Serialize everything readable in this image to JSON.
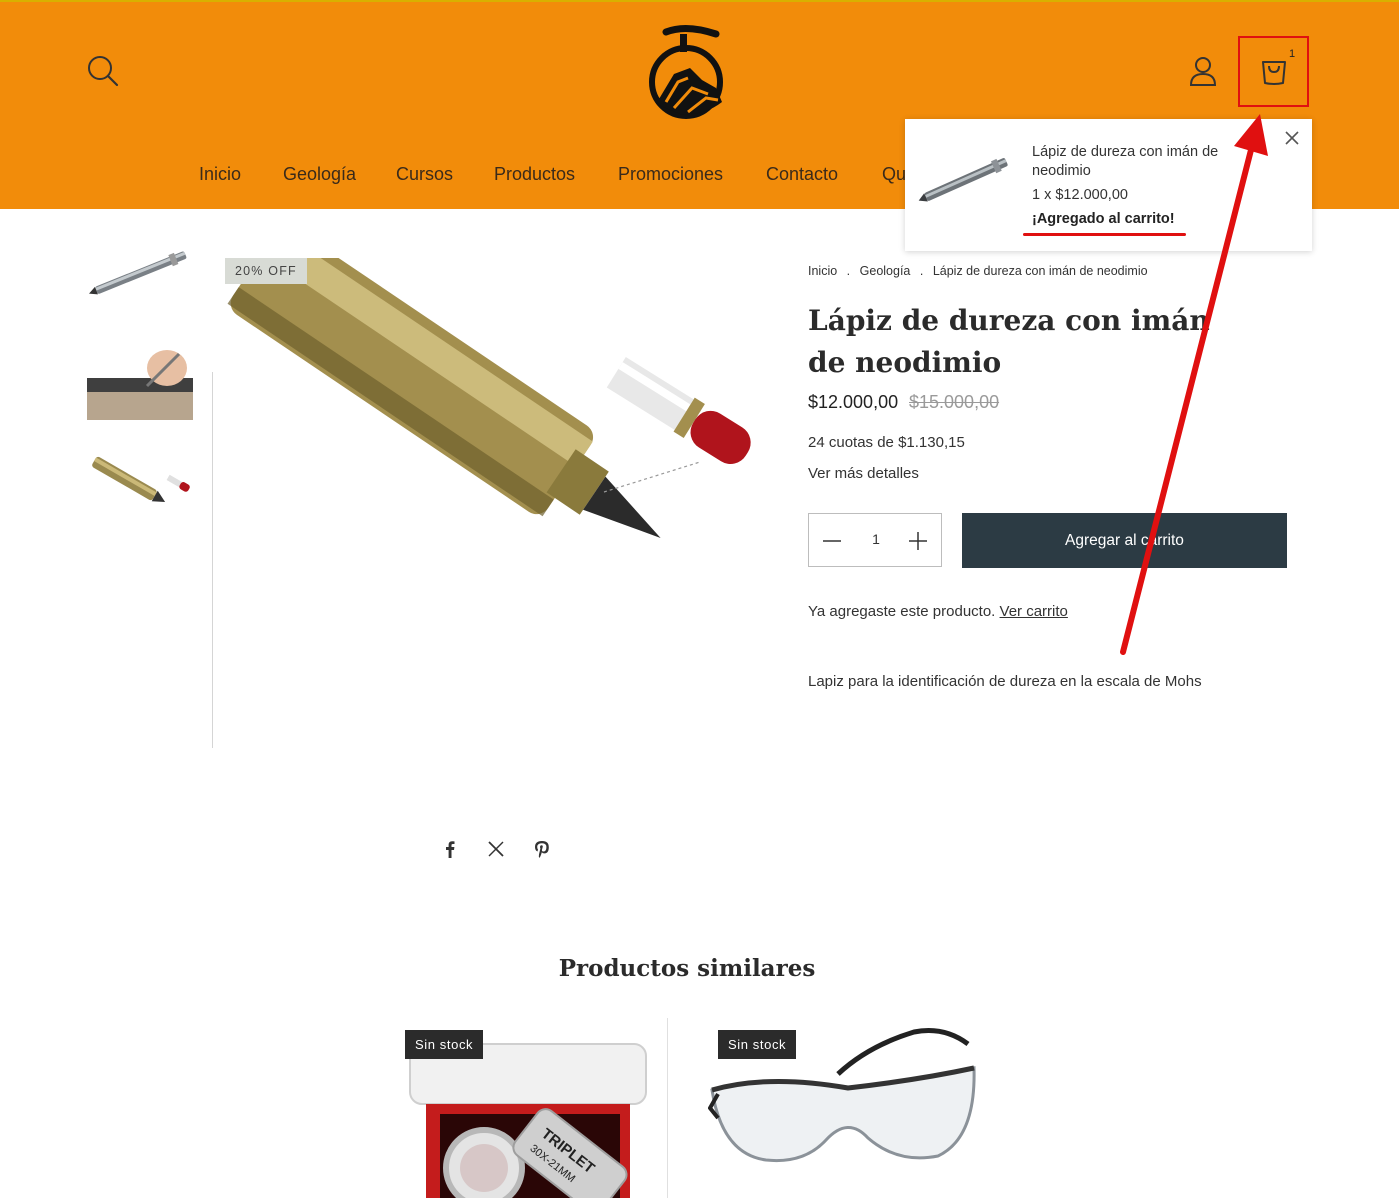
{
  "header": {
    "cart_count": "1",
    "nav": [
      "Inicio",
      "Geología",
      "Cursos",
      "Productos",
      "Promociones",
      "Contacto",
      "Qu"
    ]
  },
  "popup": {
    "title": "Lápiz de dureza con imán de neodimio",
    "qty_price": "1 x $12.000,00",
    "added": "¡Agregado al carrito!"
  },
  "gallery": {
    "badge": "20% OFF"
  },
  "breadcrumb": {
    "items": [
      "Inicio",
      "Geología",
      "Lápiz de dureza con imán de neodimio"
    ],
    "separator": "."
  },
  "product": {
    "title": "Lápiz de dureza con imán de neodimio",
    "price": "$12.000,00",
    "compare_price": "$15.000,00",
    "installments": "24 cuotas de $1.130,15",
    "details_link": "Ver más detalles",
    "quantity": "1",
    "add_button": "Agregar al carrito",
    "already_text": "Ya agregaste este producto.",
    "already_link": "Ver carrito",
    "description": "Lapiz para la identificación de dureza en la escala de Mohs"
  },
  "similar": {
    "title": "Productos similares",
    "items": [
      {
        "badge": "Sin stock"
      },
      {
        "badge": "Sin stock"
      }
    ],
    "loupe_text": [
      "TRIPLET",
      "30X-21MM"
    ]
  },
  "colors": {
    "header_bg": "#f28c0a",
    "button_bg": "#2c3b44",
    "annotation": "#e01010"
  }
}
